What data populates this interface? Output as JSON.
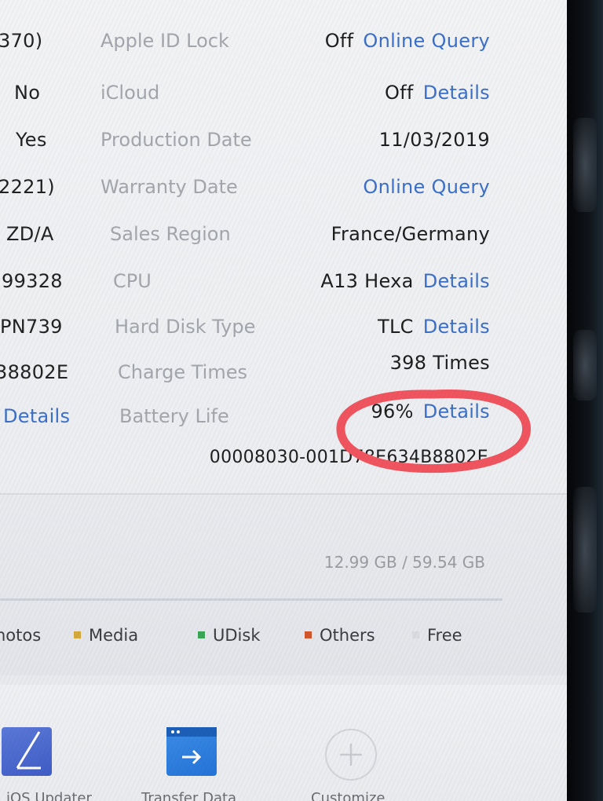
{
  "left_column": [
    {
      "text": "370)",
      "link": false
    },
    {
      "text": "No",
      "link": false
    },
    {
      "text": "Yes",
      "link": false
    },
    {
      "text": "2221)",
      "link": false
    },
    {
      "text": "ZD/A",
      "link": false
    },
    {
      "text": "99328",
      "link": false
    },
    {
      "text": "PN739",
      "link": false
    },
    {
      "text": "38802E",
      "link": false
    },
    {
      "text": "Details",
      "link": true
    }
  ],
  "info_rows": [
    {
      "label": "Apple ID Lock",
      "value": "Off",
      "link": "Online Query"
    },
    {
      "label": "iCloud",
      "value": "Off",
      "link": "Details"
    },
    {
      "label": "Production Date",
      "value": "11/03/2019",
      "link": ""
    },
    {
      "label": "Warranty Date",
      "value": "",
      "link": "Online Query"
    },
    {
      "label": "Sales Region",
      "value": "France/Germany",
      "link": ""
    },
    {
      "label": "CPU",
      "value": "A13 Hexa",
      "link": "Details"
    },
    {
      "label": "Hard Disk Type",
      "value": "TLC",
      "link": "Details"
    },
    {
      "label": "Charge Times",
      "value": "398 Times",
      "link": ""
    },
    {
      "label": "Battery Life",
      "value": "96%",
      "link": "Details"
    }
  ],
  "udid": "00008030-001D78E634B8802E",
  "storage": {
    "capacity": "12.99 GB / 59.54 GB",
    "legend": [
      {
        "label": "hotos",
        "color": ""
      },
      {
        "label": "Media",
        "color": "#d4a83a"
      },
      {
        "label": "UDisk",
        "color": "#3aa655"
      },
      {
        "label": "Others",
        "color": "#d2552c"
      },
      {
        "label": "Free",
        "color": "#d9dbe0"
      }
    ]
  },
  "toolbar": {
    "labels": [
      "iOS Updater",
      "Transfer Data",
      "Customize"
    ]
  },
  "colors": {
    "link": "#3b6fc9",
    "annotation": "#f0555f"
  }
}
